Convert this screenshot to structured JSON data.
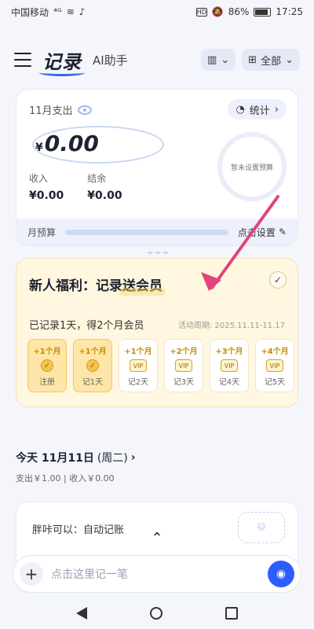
{
  "status_bar": {
    "carrier": "中国移动",
    "signal": "⁴ᴳ",
    "battery": "86%",
    "time": "17:25",
    "hd": "HD"
  },
  "header": {
    "title": "记录",
    "subtitle": "AI助手",
    "book_icon": "book-icon",
    "filter_label": "全部"
  },
  "summary_card": {
    "month_label": "11月支出",
    "amount_symbol": "¥",
    "amount": "0.00",
    "stats_label": "统计",
    "budget_circle_text": "暂未设置预算",
    "income_label": "收入",
    "income_value": "¥0.00",
    "balance_label": "结余",
    "balance_value": "¥0.00",
    "budget_label": "月预算",
    "budget_action": "点击设置"
  },
  "promo": {
    "title_prefix": "新人福利：记录",
    "title_highlight": "送会员",
    "subtitle": "已记录1天，得2个月会员",
    "period": "活动周期: 2025.11.11-11.17",
    "rewards": [
      {
        "top": "+1个月",
        "bottom": "注册",
        "done": true
      },
      {
        "top": "+1个月",
        "bottom": "记1天",
        "done": true
      },
      {
        "top": "+1个月",
        "bottom": "记2天",
        "done": false
      },
      {
        "top": "+2个月",
        "bottom": "记3天",
        "done": false
      },
      {
        "top": "+3个月",
        "bottom": "记4天",
        "done": false
      },
      {
        "top": "+4个月",
        "bottom": "记5天",
        "done": false
      }
    ]
  },
  "today": {
    "title": "今天 11月11日",
    "weekday": "(周二)",
    "meta": "支出￥1.00 | 收入￥0.00"
  },
  "auto_card": {
    "text": "胖咔可以：自动记账"
  },
  "input": {
    "placeholder": "点击这里记一笔"
  }
}
